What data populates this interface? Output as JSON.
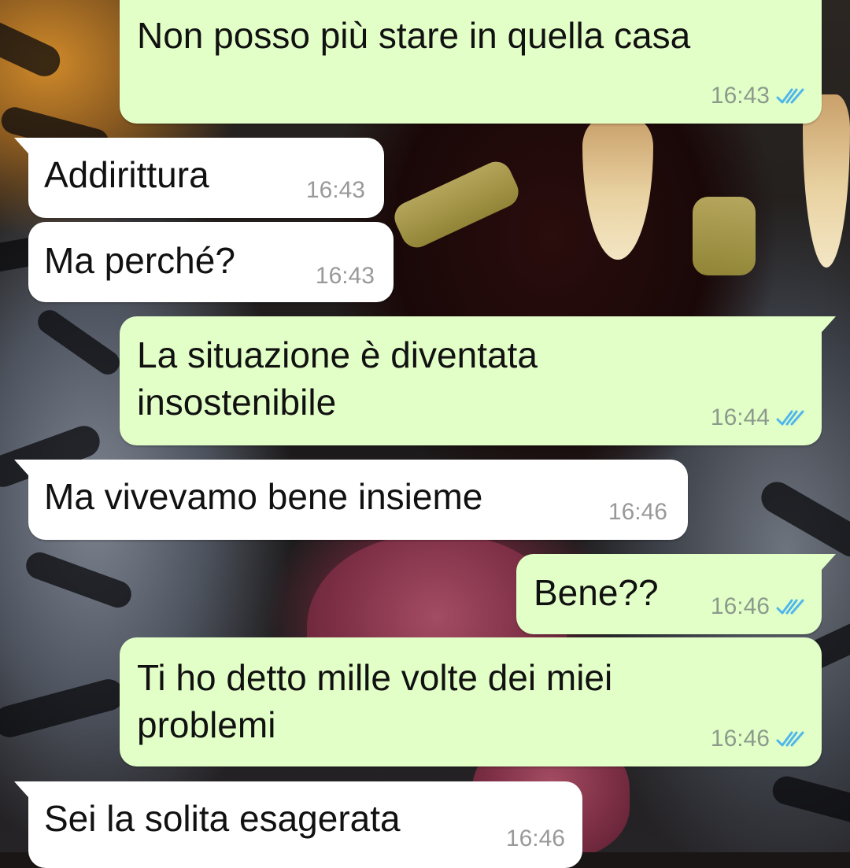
{
  "theme": {
    "outgoing_bubble": "#e2ffc7",
    "incoming_bubble": "#ffffff",
    "read_tick_color": "#4fb6ec",
    "timestamp_color": "#8c9a8c"
  },
  "messages": [
    {
      "direction": "outgoing",
      "lines": [
        "Non posso più stare in quella casa"
      ],
      "time": "16:43",
      "status_icon": "double-check-read-icon"
    },
    {
      "direction": "incoming",
      "lines": [
        "Addirittura"
      ],
      "time": "16:43"
    },
    {
      "direction": "incoming",
      "lines": [
        "Ma perché?"
      ],
      "time": "16:43"
    },
    {
      "direction": "outgoing",
      "lines": [
        "La situazione è diventata",
        "insostenibile"
      ],
      "time": "16:44",
      "status_icon": "double-check-read-icon"
    },
    {
      "direction": "incoming",
      "lines": [
        "Ma vivevamo bene insieme"
      ],
      "time": "16:46"
    },
    {
      "direction": "outgoing",
      "lines": [
        "Bene??"
      ],
      "time": "16:46",
      "status_icon": "double-check-read-icon"
    },
    {
      "direction": "outgoing",
      "lines": [
        "Ti ho detto mille volte dei miei",
        "problemi"
      ],
      "time": "16:46",
      "status_icon": "double-check-read-icon"
    },
    {
      "direction": "incoming",
      "lines": [
        "Sei la solita esagerata"
      ],
      "time": "16:46"
    }
  ]
}
